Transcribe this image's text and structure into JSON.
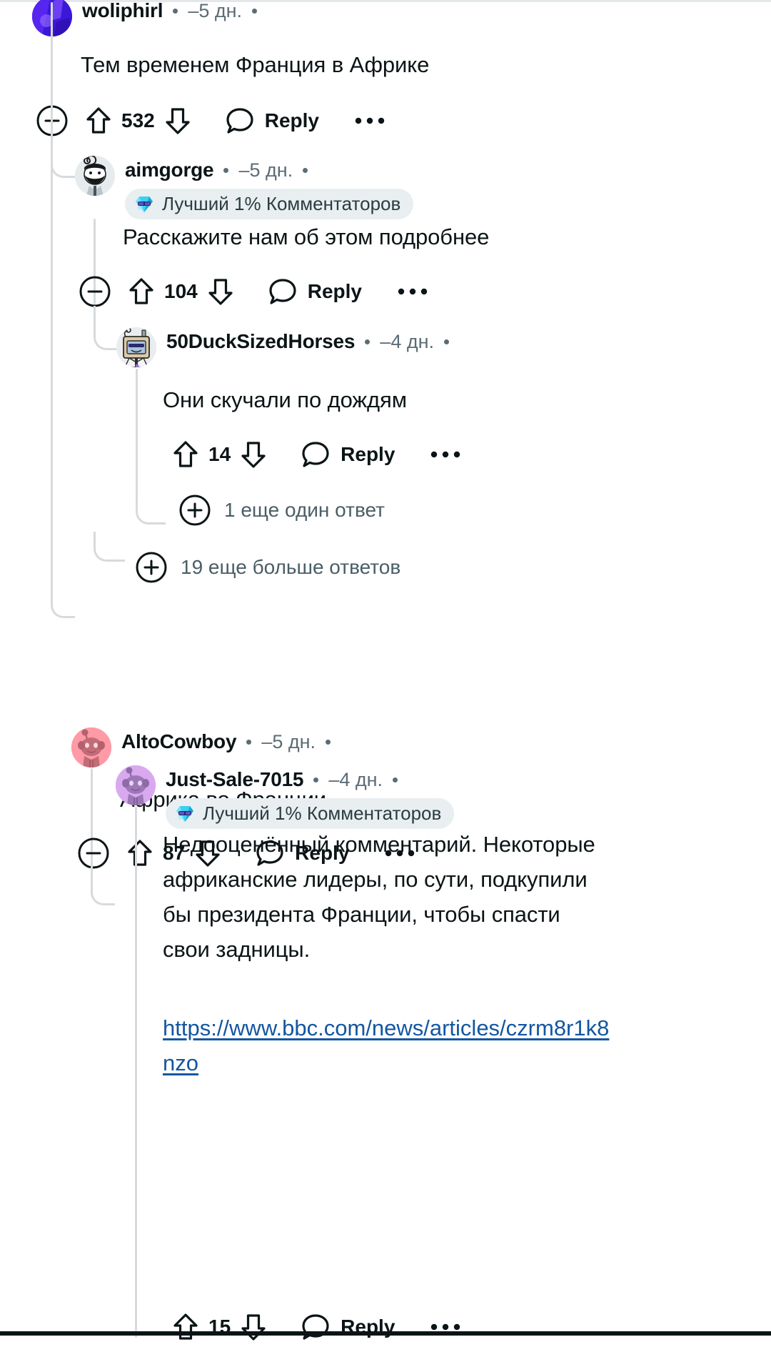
{
  "thread": {
    "comments": [
      {
        "id": "c1",
        "username": "woliphirl",
        "age": "–5 дн.",
        "avatar": "avatar-blue-photo",
        "badge": null,
        "body": "Тем временем Франция в Африке",
        "score": "532",
        "reply_label": "Reply",
        "collapse_icon": "minus-circle-icon",
        "upvote_icon": "upvote-arrow-icon",
        "downvote_icon": "downvote-arrow-icon",
        "comment_icon": "comment-bubble-icon",
        "more_icon": "ellipsis-icon"
      },
      {
        "id": "c2",
        "username": "aimgorge",
        "age": "–5 дн.",
        "avatar": "avatar-beard-snoo",
        "badge": "Лучший 1% Комментаторов",
        "badge_icon": "gem-sunglasses-icon",
        "body": "Расскажите нам об этом подробнее",
        "score": "104",
        "reply_label": "Reply",
        "collapse_icon": "minus-circle-icon",
        "upvote_icon": "upvote-arrow-icon",
        "downvote_icon": "downvote-arrow-icon",
        "comment_icon": "comment-bubble-icon",
        "more_icon": "ellipsis-icon"
      },
      {
        "id": "c3",
        "username": "50DuckSizedHorses",
        "age": "–4 дн.",
        "avatar": "avatar-tv-head-snoo",
        "badge": null,
        "body": "Они скучали по дождям",
        "score": "14",
        "reply_label": "Reply",
        "upvote_icon": "upvote-arrow-icon",
        "downvote_icon": "downvote-arrow-icon",
        "comment_icon": "comment-bubble-icon",
        "more_icon": "ellipsis-icon"
      },
      {
        "id": "c4",
        "username": "AltoCowboy",
        "age": "–5 дн.",
        "avatar": "avatar-pink-snoo",
        "badge": null,
        "body": "Африка во Франции",
        "score": "87",
        "reply_label": "Reply",
        "collapse_icon": "minus-circle-icon",
        "upvote_icon": "upvote-arrow-icon",
        "downvote_icon": "downvote-arrow-icon",
        "comment_icon": "comment-bubble-icon",
        "more_icon": "ellipsis-icon"
      },
      {
        "id": "c5",
        "username": "Just-Sale-7015",
        "age": "–4 дн.",
        "avatar": "avatar-purple-snoo",
        "badge": "Лучший 1% Комментаторов",
        "badge_icon": "gem-sunglasses-icon",
        "body": "Недооценённый комментарий. Некоторые африканские лидеры, по сути, подкупили бы президента Франции, чтобы спасти свои задницы.",
        "link": "https://www.bbc.com/news/articles/czrm8r1k8nzo",
        "score": "15",
        "reply_label": "Reply",
        "upvote_icon": "upvote-arrow-icon",
        "downvote_icon": "downvote-arrow-icon",
        "comment_icon": "comment-bubble-icon",
        "more_icon": "ellipsis-icon"
      }
    ],
    "expanders": [
      {
        "id": "e1",
        "label": "1 еще один ответ",
        "icon": "plus-circle-icon"
      },
      {
        "id": "e2",
        "label": "19 еще больше ответов",
        "icon": "plus-circle-icon"
      }
    ]
  },
  "colors": {
    "text": "#0b1416",
    "muted": "#5c6c74",
    "link": "#1356a2",
    "rail": "#d7dadc",
    "badge_bg": "#e9eef0",
    "avatar_pink": "#ff9aa6",
    "avatar_purple": "#d9a9ef",
    "avatar_blue": "#3b17d6"
  }
}
